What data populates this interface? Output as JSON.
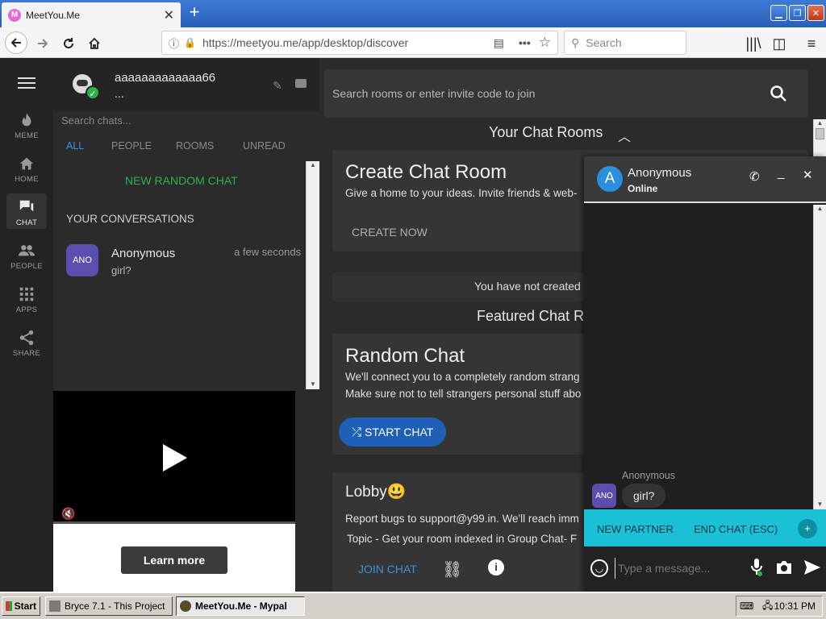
{
  "browser": {
    "tab_title": "MeetYou.Me",
    "tab_favicon": "M",
    "url": "https://meetyou.me/app/desktop/discover",
    "search_placeholder": "Search"
  },
  "rail": {
    "items": [
      {
        "label": "MEME",
        "icon": "flame-icon"
      },
      {
        "label": "HOME",
        "icon": "home-icon"
      },
      {
        "label": "CHAT",
        "icon": "chat-icon"
      },
      {
        "label": "PEOPLE",
        "icon": "people-icon"
      },
      {
        "label": "APPS",
        "icon": "apps-icon"
      },
      {
        "label": "SHARE",
        "icon": "share-icon"
      }
    ]
  },
  "user": {
    "name": "aaaaaaaaaaaaa66",
    "status": "..."
  },
  "chats": {
    "search_placeholder": "Search chats...",
    "filters": [
      "ALL",
      "PEOPLE",
      "ROOMS",
      "UNREAD"
    ],
    "new_random": "NEW RANDOM CHAT",
    "section_title": "YOUR CONVERSATIONS",
    "conversation": {
      "avatar": "ANO",
      "name": "Anonymous",
      "time": "a few seconds",
      "preview": "girl?"
    }
  },
  "ad": {
    "learn_more": "Learn more"
  },
  "main": {
    "room_search_placeholder": "Search rooms or enter invite code to join",
    "your_rooms_title": "Your Chat Rooms",
    "create_title": "Create Chat Room",
    "create_desc": "Give a home to your ideas. Invite friends & web-",
    "create_btn": "CREATE NOW",
    "not_created": "You have not created a",
    "featured_title": "Featured Chat Ro",
    "random_title": "Random Chat",
    "random_desc1": "We'll connect you to a completely random strang",
    "random_desc2": "Make sure not to tell strangers personal stuff abo",
    "start_chat": "START CHAT",
    "lobby_title": "Lobby😃",
    "lobby_desc": "Report bugs to support@y99.in. We'll reach imm",
    "lobby_topic": "Topic - Get your room indexed in Group Chat- F",
    "join_chat": "JOIN CHAT"
  },
  "popup": {
    "avatar": "A",
    "name": "Anonymous",
    "status": "Online",
    "msg_sender": "Anonymous",
    "msg_avatar": "ANO",
    "msg_text": "girl?",
    "new_partner": "NEW PARTNER",
    "end_chat": "END CHAT (ESC)",
    "input_placeholder": "Type a message..."
  },
  "taskbar": {
    "start": "Start",
    "task1": "Bryce 7.1 - This Project",
    "task2": "MeetYou.Me - Mypal",
    "clock": "10:31 PM"
  },
  "colors": {
    "accent_cyan": "#19c0d6",
    "start_blue": "#1e5fb8",
    "green": "#2db24a"
  }
}
